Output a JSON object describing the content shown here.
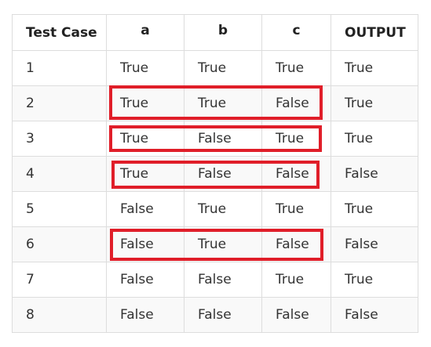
{
  "table": {
    "headers": [
      "Test Case",
      "a",
      "b",
      "c",
      "OUTPUT"
    ],
    "rows": [
      [
        "1",
        "True",
        "True",
        "True",
        "True"
      ],
      [
        "2",
        "True",
        "True",
        "False",
        "True"
      ],
      [
        "3",
        "True",
        "False",
        "True",
        "True"
      ],
      [
        "4",
        "True",
        "False",
        "False",
        "False"
      ],
      [
        "5",
        "False",
        "True",
        "True",
        "True"
      ],
      [
        "6",
        "False",
        "True",
        "False",
        "False"
      ],
      [
        "7",
        "False",
        "False",
        "True",
        "True"
      ],
      [
        "8",
        "False",
        "False",
        "False",
        "False"
      ]
    ]
  },
  "highlight": {
    "color": "#e01e29",
    "highlighted_test_cases": [
      "2",
      "3",
      "4",
      "6"
    ]
  }
}
